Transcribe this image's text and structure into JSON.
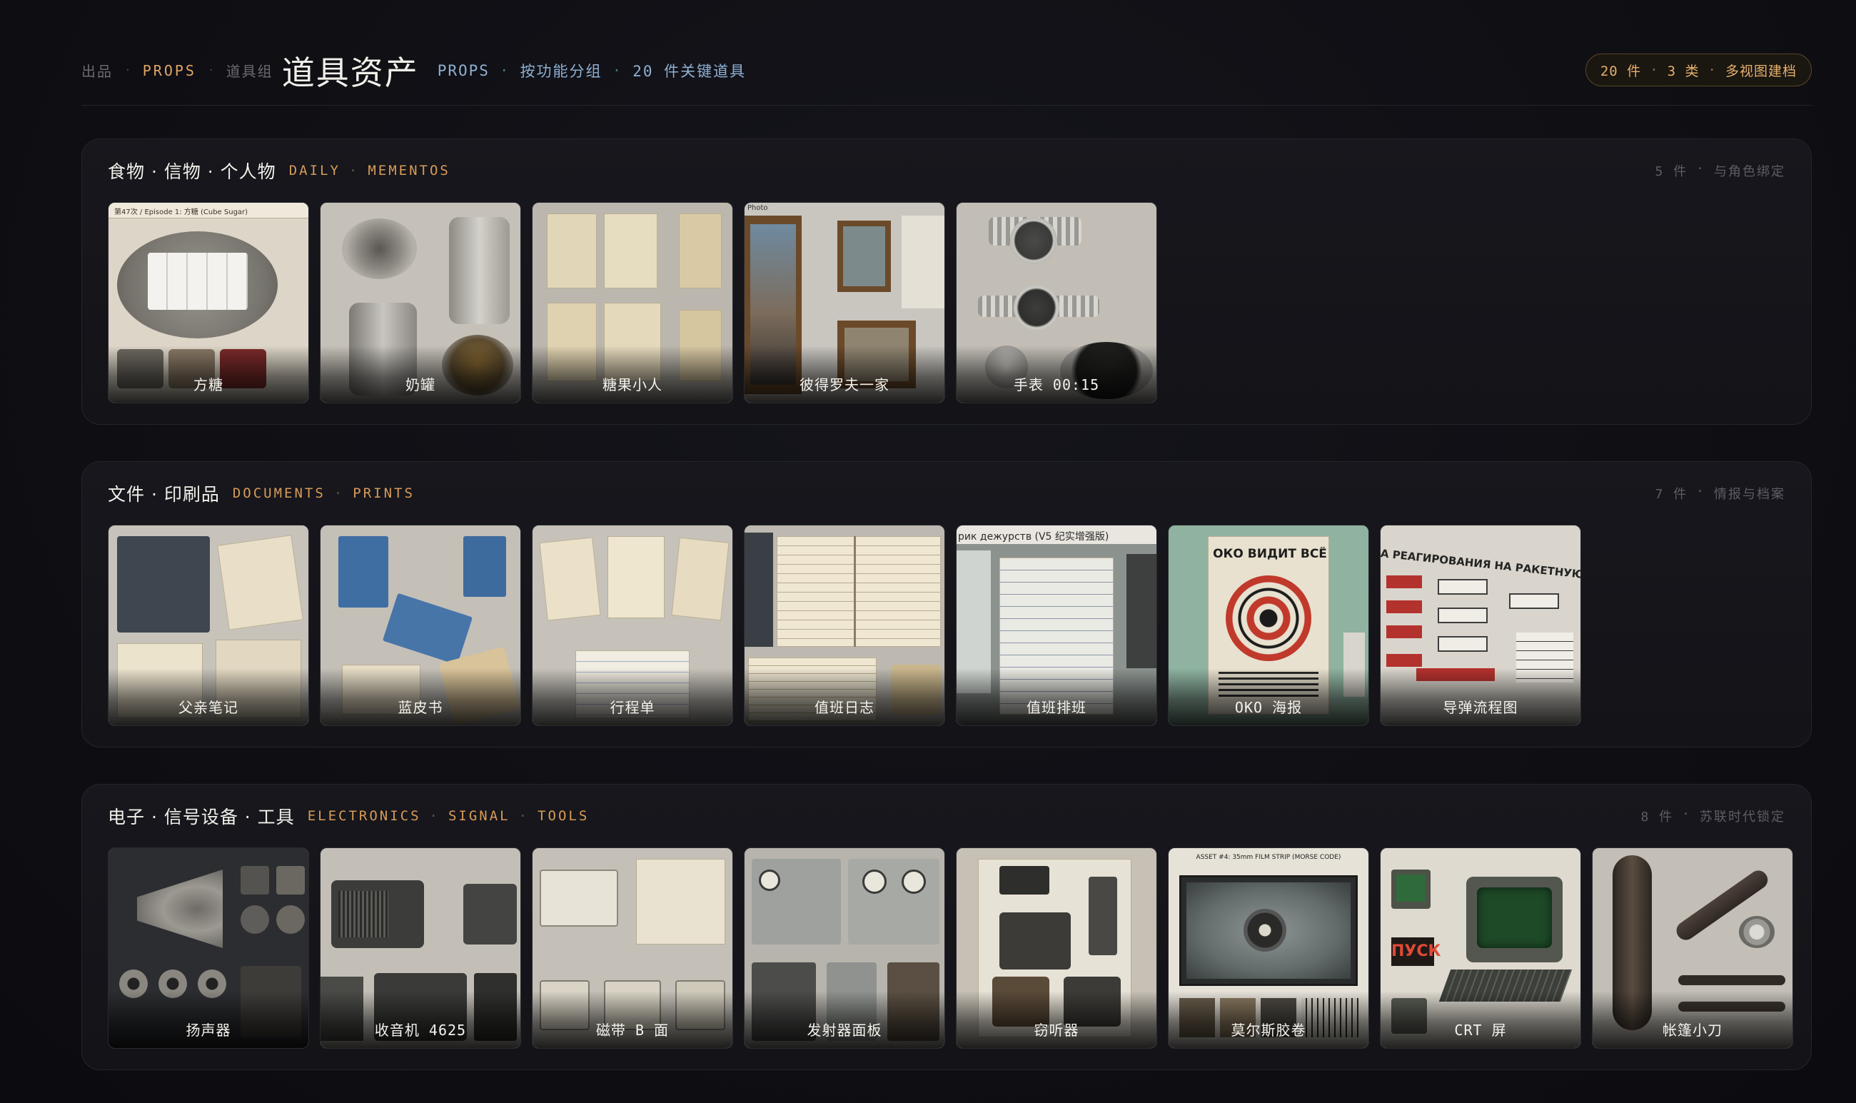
{
  "header": {
    "breadcrumbs": [
      "出品",
      "PROPS",
      "道具组"
    ],
    "title": "道具资产",
    "subtitle": [
      "PROPS",
      "按功能分组",
      "20 件关键道具"
    ],
    "summary": [
      "20 件",
      "3 类",
      "多视图建档"
    ]
  },
  "groups": [
    {
      "title": "食物 · 信物 · 个人物",
      "tags": [
        "DAILY",
        "MEMENTOS"
      ],
      "meta": [
        "5 件",
        "与角色绑定"
      ],
      "items": [
        {
          "label": "方糖",
          "image_text": "第47次 / Episode 1: 方糖 (Cube Sugar)"
        },
        {
          "label": "奶罐"
        },
        {
          "label": "糖果小人"
        },
        {
          "label": "彼得罗夫一家",
          "image_text": "Photo"
        },
        {
          "label": "手表 00:15"
        }
      ]
    },
    {
      "title": "文件 · 印刷品",
      "tags": [
        "DOCUMENTS",
        "PRINTS"
      ],
      "meta": [
        "7 件",
        "情报与档案"
      ],
      "items": [
        {
          "label": "父亲笔记"
        },
        {
          "label": "蓝皮书"
        },
        {
          "label": "行程单"
        },
        {
          "label": "值班日志"
        },
        {
          "label": "值班排班",
          "image_text": "рик дежурств (V5 纪实增强版)"
        },
        {
          "label": "OKO 海报",
          "image_text": "ОКО ВИДИТ ВСЁ"
        },
        {
          "label": "导弹流程图",
          "image_text": "А РЕАГИРОВАНИЯ НА РАКЕТНУЮ ОПАСНОСТЬ"
        }
      ]
    },
    {
      "title": "电子 · 信号设备 · 工具",
      "tags": [
        "ELECTRONICS",
        "SIGNAL",
        "TOOLS"
      ],
      "meta": [
        "8 件",
        "苏联时代锁定"
      ],
      "items": [
        {
          "label": "扬声器"
        },
        {
          "label": "收音机 4625"
        },
        {
          "label": "磁带 B 面"
        },
        {
          "label": "发射器面板"
        },
        {
          "label": "窃听器"
        },
        {
          "label": "莫尔斯胶卷",
          "image_text": "ASSET #4: 35mm FILM STRIP (MORSE CODE)"
        },
        {
          "label": "CRT 屏",
          "image_text": "ПУСК"
        },
        {
          "label": "帐篷小刀"
        }
      ]
    }
  ],
  "colors": {
    "background": "#0f0f14",
    "accent_orange": "#e0a565",
    "accent_blue": "#8fb0d2",
    "panel_border": "#24242b"
  }
}
